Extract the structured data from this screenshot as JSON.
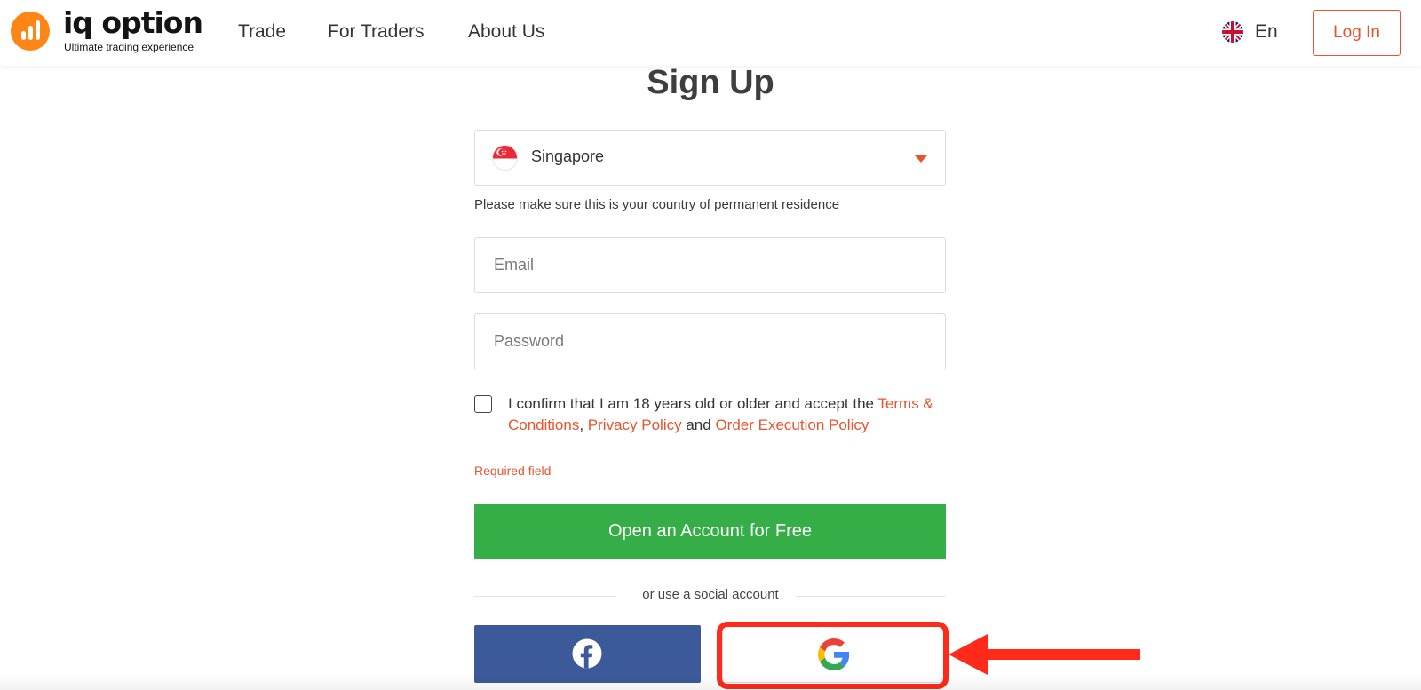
{
  "brand": {
    "name": "iq option",
    "tagline": "Ultimate trading experience",
    "color": "#ff8516"
  },
  "nav": {
    "items": [
      {
        "label": "Trade"
      },
      {
        "label": "For Traders"
      },
      {
        "label": "About Us"
      }
    ],
    "language": "En",
    "login_label": "Log In"
  },
  "form": {
    "title": "Sign Up",
    "country": {
      "selected": "Singapore",
      "hint": "Please make sure this is your country of permanent residence"
    },
    "email": {
      "placeholder": "Email",
      "value": ""
    },
    "password": {
      "placeholder": "Password",
      "value": ""
    },
    "consent": {
      "checked": false,
      "text_before": "I confirm that I am 18 years old or older and accept the",
      "terms": "Terms & Conditions",
      "comma": ",",
      "privacy": "Privacy Policy",
      "and": "and",
      "execution": "Order Execution Policy"
    },
    "error": "Required field",
    "submit_label": "Open an Account for Free",
    "social_divider": "or use a social account"
  },
  "colors": {
    "accent": "#e8542e",
    "submit": "#35ae47",
    "facebook": "#3c5a9a",
    "highlight": "#ff2a1a"
  },
  "icons": {
    "facebook": "facebook-icon",
    "google": "google-icon",
    "flag_uk": "flag-uk-icon",
    "flag_sg": "flag-singapore-icon",
    "caret": "caret-down-icon"
  }
}
